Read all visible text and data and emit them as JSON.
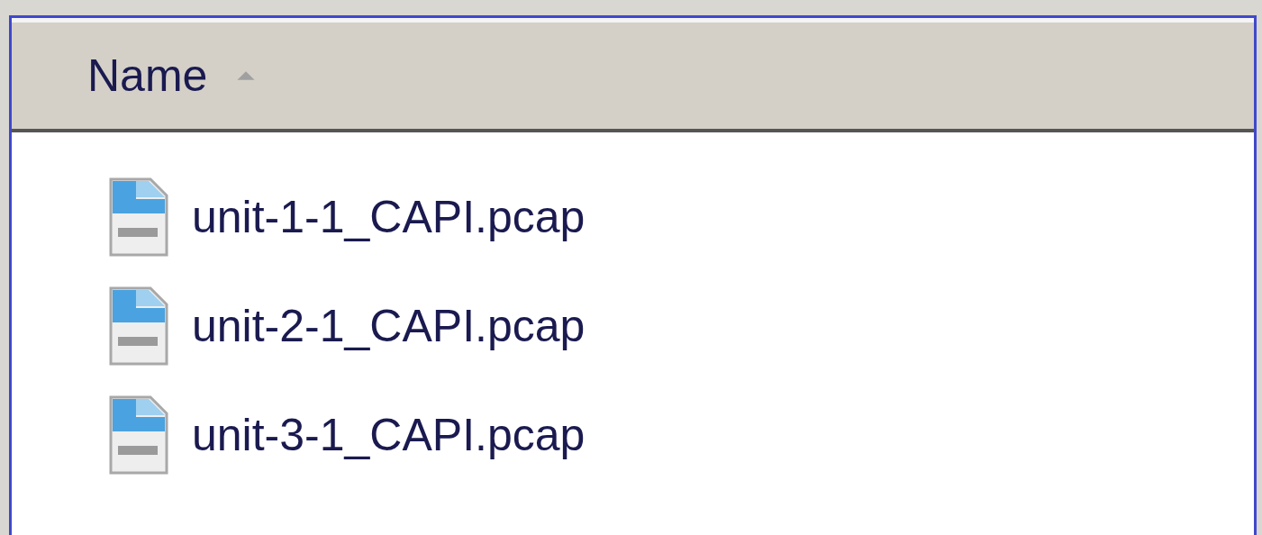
{
  "columns": [
    {
      "label": "Name",
      "sorted": true,
      "ascending": true
    }
  ],
  "files": [
    {
      "name": "unit-1-1_CAPI.pcap"
    },
    {
      "name": "unit-2-1_CAPI.pcap"
    },
    {
      "name": "unit-3-1_CAPI.pcap"
    }
  ]
}
